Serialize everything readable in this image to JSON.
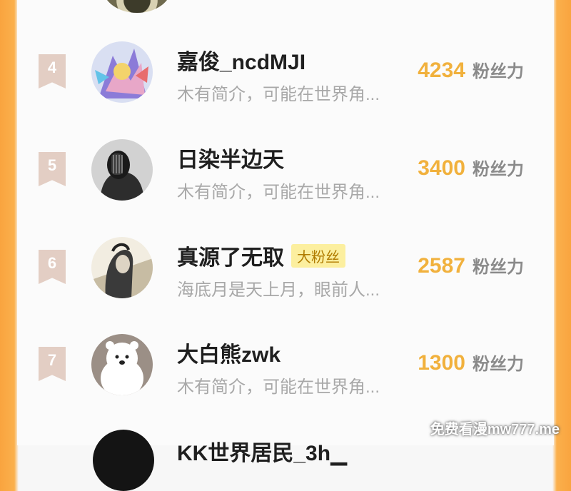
{
  "rows": [
    {
      "rank": "4",
      "name": "嘉俊_ncdMJI",
      "badge": "",
      "bio": "木有简介，可能在世界角...",
      "fans_count": "4234",
      "fans_label": "粉丝力",
      "avatar_icon": "mecha-art-avatar-icon"
    },
    {
      "rank": "5",
      "name": "日染半边天",
      "badge": "",
      "bio": "木有简介，可能在世界角...",
      "fans_count": "3400",
      "fans_label": "粉丝力",
      "avatar_icon": "masked-person-avatar-icon"
    },
    {
      "rank": "6",
      "name": "真源了无取",
      "badge": "大粉丝",
      "bio": "海底月是天上月，眼前人...",
      "fans_count": "2587",
      "fans_label": "粉丝力",
      "avatar_icon": "sketch-girl-avatar-icon"
    },
    {
      "rank": "7",
      "name": "大白熊zwk",
      "badge": "",
      "bio": "木有简介，可能在世界角...",
      "fans_count": "1300",
      "fans_label": "粉丝力",
      "avatar_icon": "white-bear-avatar-icon"
    }
  ],
  "partial_next_row_name": "KK世界居民_3h▁",
  "watermark": "免费看漫mw777.me",
  "colors": {
    "accent_orange": "#f9a43f",
    "fans_count": "#f1b13d",
    "rank_flag": "#e3cec4",
    "badge_bg": "#fcef9f"
  }
}
